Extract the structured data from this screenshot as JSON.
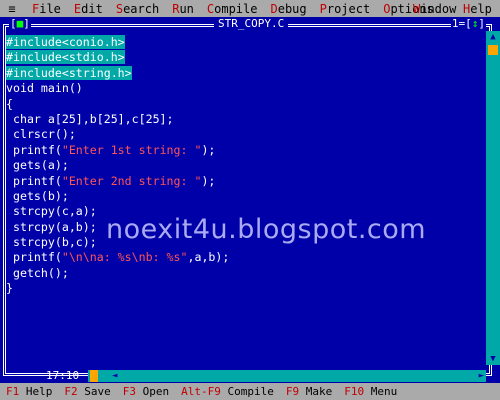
{
  "menubar": {
    "system_icon": "≡",
    "items": [
      {
        "hot": "F",
        "rest": "ile"
      },
      {
        "hot": "E",
        "rest": "dit"
      },
      {
        "hot": "S",
        "rest": "earch"
      },
      {
        "hot": "R",
        "rest": "un"
      },
      {
        "hot": "C",
        "rest": "ompile"
      },
      {
        "hot": "D",
        "rest": "ebug"
      },
      {
        "hot": "P",
        "rest": "roject"
      },
      {
        "hot": "O",
        "rest": "ptions"
      }
    ],
    "window": {
      "hot": "W",
      "rest": "indow"
    },
    "help": {
      "hot": "H",
      "rest": "elp"
    }
  },
  "window": {
    "title": " STR_COPY.C ",
    "close_left": "[",
    "close_glyph": "■",
    "close_right": "]",
    "number": "1",
    "zoom_left": "[",
    "zoom_glyph": "↕",
    "zoom_right": "]"
  },
  "editor": {
    "lines": [
      {
        "pp": "#include<conio.h>"
      },
      {
        "pp": "#include<stdio.h>"
      },
      {
        "pp": "#include<string.h>"
      },
      {
        "text": "void main()"
      },
      {
        "text": "{"
      },
      {
        "text": " char a[25],b[25],c[25];"
      },
      {
        "text": " clrscr();"
      },
      {
        "pre": " printf(",
        "str": "\"Enter 1st string: \"",
        "post": ");"
      },
      {
        "text": " gets(a);"
      },
      {
        "pre": " printf(",
        "str": "\"Enter 2nd string: \"",
        "post": ");"
      },
      {
        "text": " gets(b);"
      },
      {
        "text": " strcpy(c,a);"
      },
      {
        "text": " strcpy(a,b);"
      },
      {
        "text": " strcpy(b,c);"
      },
      {
        "pre": " printf(",
        "str": "\"\\n\\na: %s\\nb: %s\"",
        "post": ",a,b);"
      },
      {
        "text": " getch();"
      },
      {
        "text": "}"
      }
    ]
  },
  "cursor": {
    "position": "17:10"
  },
  "scroll": {
    "up": "▲",
    "down": "▼",
    "left": "◄",
    "right": "►"
  },
  "status": {
    "items": [
      {
        "key": "F1",
        "label": "Help"
      },
      {
        "key": "F2",
        "label": "Save"
      },
      {
        "key": "F3",
        "label": "Open"
      },
      {
        "key": "Alt-F9",
        "label": "Compile"
      },
      {
        "key": "F9",
        "label": "Make"
      },
      {
        "key": "F10",
        "label": "Menu"
      }
    ]
  },
  "watermark": "noexit4u.blogspot.com",
  "colors": {
    "background": "#0000a8",
    "menubar": "#aaaaaa",
    "hotkey": "#c00000",
    "string": "#ff5555",
    "preprocessor_bg": "#00a8a8"
  }
}
